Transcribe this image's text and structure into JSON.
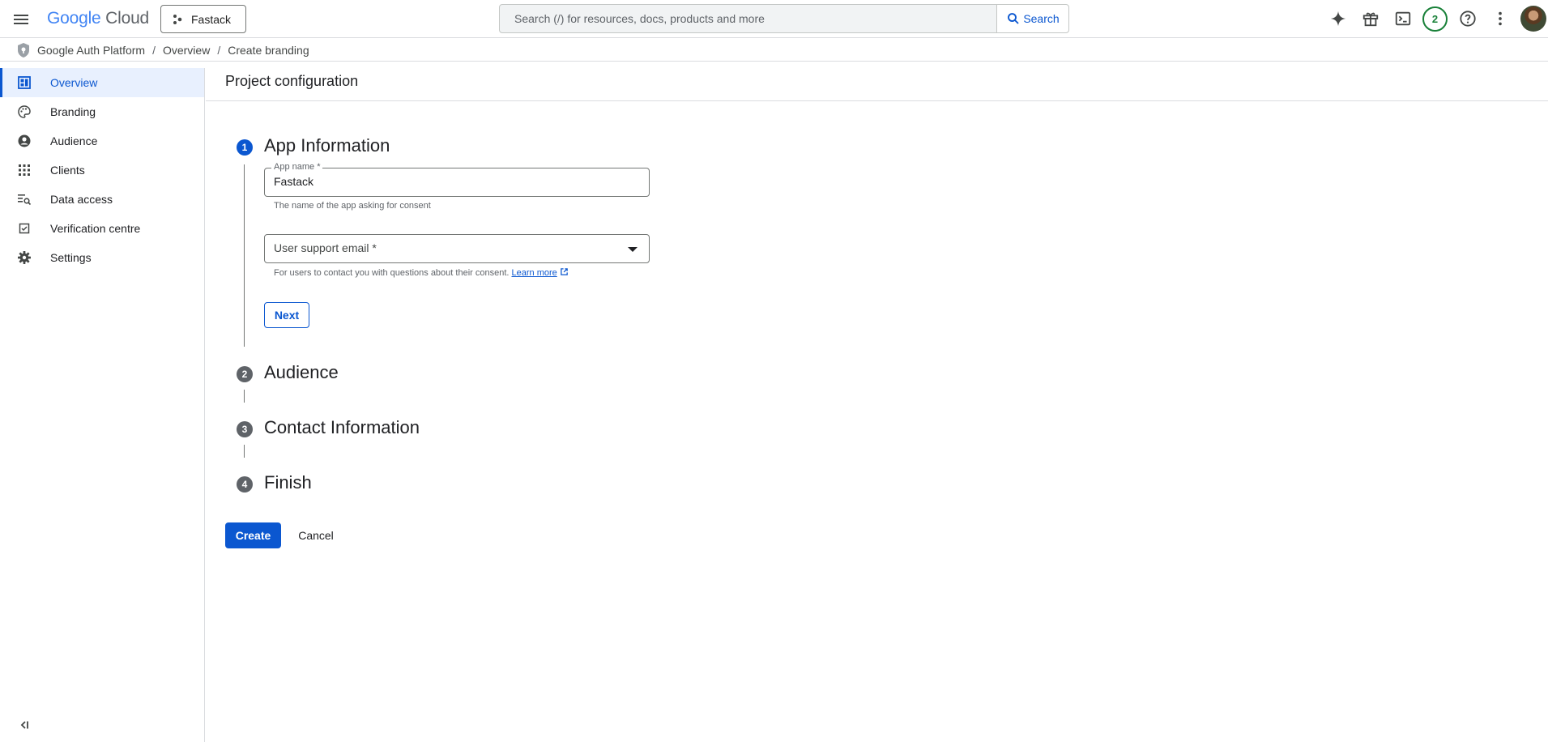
{
  "header": {
    "logo_google": "Google",
    "logo_cloud": "Cloud",
    "project_name": "Fastack",
    "search_placeholder": "Search (/) for resources, docs, products and more",
    "search_button": "Search",
    "notifications_count": "2",
    "icons": [
      "menu-icon",
      "gemini-icon",
      "gift-icon",
      "cloud-shell-icon",
      "help-icon",
      "more-vert-icon"
    ]
  },
  "breadcrumb": {
    "items": [
      "Google Auth Platform",
      "Overview",
      "Create branding"
    ],
    "separator": "/"
  },
  "sidebar": {
    "items": [
      {
        "label": "Overview",
        "icon": "dashboard-icon",
        "active": true
      },
      {
        "label": "Branding",
        "icon": "palette-icon",
        "active": false
      },
      {
        "label": "Audience",
        "icon": "account-circle-icon",
        "active": false
      },
      {
        "label": "Clients",
        "icon": "apps-grid-icon",
        "active": false
      },
      {
        "label": "Data access",
        "icon": "manage-search-icon",
        "active": false
      },
      {
        "label": "Verification centre",
        "icon": "verified-checkbox-icon",
        "active": false
      },
      {
        "label": "Settings",
        "icon": "gear-icon",
        "active": false
      }
    ]
  },
  "main": {
    "page_title": "Project configuration",
    "steps": [
      {
        "number": "1",
        "title": "App Information",
        "state": "active"
      },
      {
        "number": "2",
        "title": "Audience",
        "state": "inactive"
      },
      {
        "number": "3",
        "title": "Contact Information",
        "state": "inactive"
      },
      {
        "number": "4",
        "title": "Finish",
        "state": "inactive"
      }
    ],
    "app_name": {
      "label": "App name *",
      "value": "Fastack",
      "helper": "The name of the app asking for consent"
    },
    "support_email": {
      "placeholder": "User support email *",
      "helper": "For users to contact you with questions about their consent.",
      "learn_more": "Learn more"
    },
    "next_button": "Next",
    "create_button": "Create",
    "cancel_button": "Cancel"
  },
  "colors": {
    "primary": "#0b57d0",
    "active_nav_bg": "#e8f0fe",
    "notification_green": "#188038"
  }
}
